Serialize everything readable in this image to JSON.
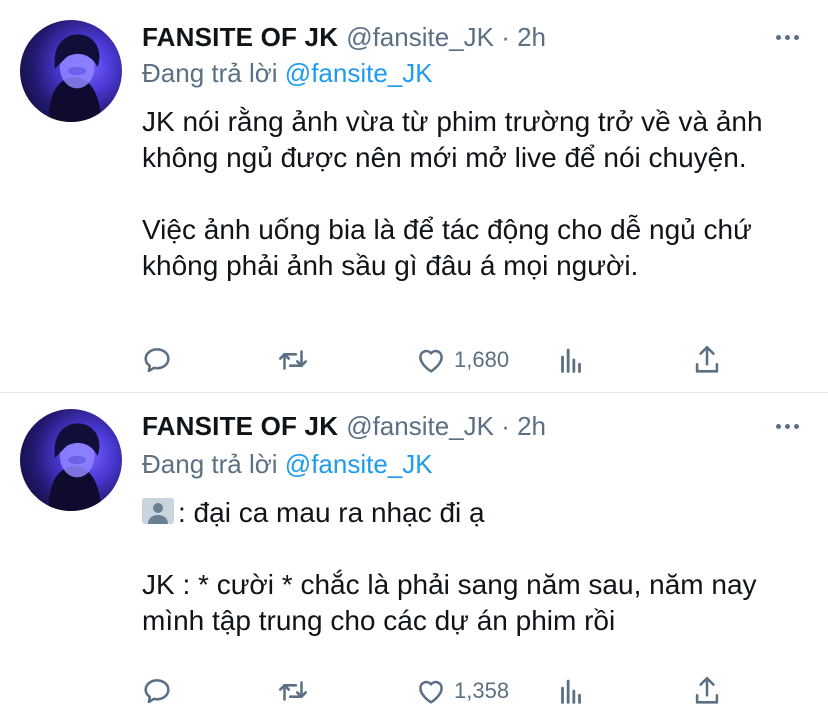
{
  "colors": {
    "text": "#0f1419",
    "muted": "#5b7083",
    "accent": "#1d9bf0",
    "divider": "#e6e9eb"
  },
  "tweets": [
    {
      "author_name": "FANSITE OF JK",
      "meta": "@fansite_JK · 2h",
      "reply_prefix": "Đang trả lời",
      "reply_handle": "@fansite_JK",
      "body_1": "JK nói rằng ảnh vừa từ phim trường trở về và ảnh không ngủ được nên mới mở live để nói chuyện.",
      "body_2": "Việc ảnh uống bia là để tác động cho dễ ngủ chứ không phải ảnh sầu gì đâu á mọi người.",
      "likes": "1,680",
      "icons": [
        "reply-icon",
        "retweet-icon",
        "heart-icon",
        "analytics-icon",
        "share-icon",
        "more-icon"
      ]
    },
    {
      "author_name": "FANSITE OF JK",
      "meta": "@fansite_JK · 2h",
      "reply_prefix": "Đang trả lời",
      "reply_handle": "@fansite_JK",
      "body_1": ": đại ca mau ra nhạc đi ạ",
      "body_2": "JK : * cười * chắc là phải sang năm sau, năm nay mình tập trung cho các dự án phim rồi",
      "likes": "1,358",
      "icons": [
        "person-icon",
        "reply-icon",
        "retweet-icon",
        "heart-icon",
        "analytics-icon",
        "share-icon",
        "more-icon"
      ]
    }
  ]
}
